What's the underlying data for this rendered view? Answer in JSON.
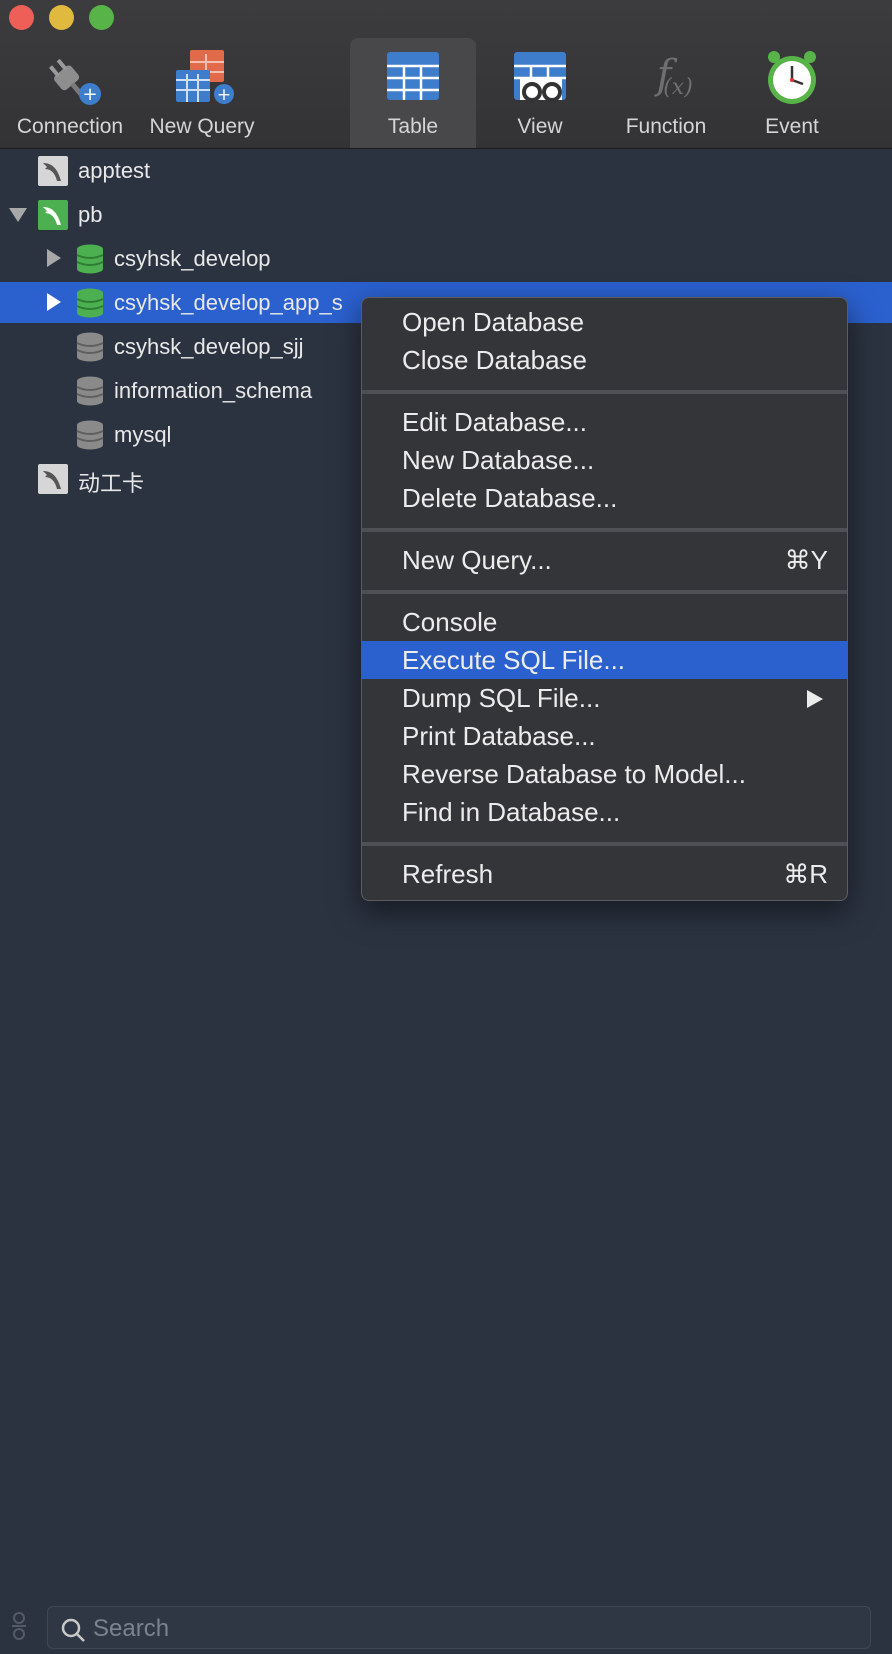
{
  "toolbar": {
    "items": [
      {
        "label": "Connection",
        "icon": "connection-plug-icon"
      },
      {
        "label": "New Query",
        "icon": "new-query-icon"
      },
      {
        "label": "Table",
        "icon": "table-icon",
        "active": true
      },
      {
        "label": "View",
        "icon": "view-icon"
      },
      {
        "label": "Function",
        "icon": "function-icon"
      },
      {
        "label": "Event",
        "icon": "event-clock-icon"
      }
    ]
  },
  "tree": {
    "items": [
      {
        "label": "apptest",
        "icon": "mysql-connection-icon",
        "level": 0
      },
      {
        "label": "pb",
        "icon": "mysql-connection-active-icon",
        "level": 0,
        "expanded": true
      },
      {
        "label": "csyhsk_develop",
        "icon": "database-open-icon",
        "level": 1
      },
      {
        "label": "csyhsk_develop_app_s",
        "icon": "database-open-icon",
        "level": 1,
        "selected": true
      },
      {
        "label": "csyhsk_develop_sjj",
        "icon": "database-closed-icon",
        "level": 1
      },
      {
        "label": "information_schema",
        "icon": "database-closed-icon",
        "level": 1
      },
      {
        "label": "mysql",
        "icon": "database-closed-icon",
        "level": 1
      },
      {
        "label": "动工卡",
        "icon": "mysql-connection-icon",
        "level": 0
      }
    ]
  },
  "context_menu": {
    "items": [
      {
        "label": "Open Database"
      },
      {
        "label": "Close Database"
      },
      {
        "label": "Edit Database..."
      },
      {
        "label": "New Database..."
      },
      {
        "label": "Delete Database..."
      },
      {
        "label": "New Query...",
        "shortcut": "⌘Y"
      },
      {
        "label": "Console"
      },
      {
        "label": "Execute SQL File...",
        "highlighted": true
      },
      {
        "label": "Dump SQL File...",
        "submenu": true
      },
      {
        "label": "Print Database..."
      },
      {
        "label": "Reverse Database to Model..."
      },
      {
        "label": "Find in Database..."
      },
      {
        "label": "Refresh",
        "shortcut": "⌘R"
      }
    ]
  },
  "search": {
    "placeholder": "Search"
  },
  "colors": {
    "selection": "#2b60cf",
    "background": "#2b3341",
    "menu_bg": "#333539",
    "db_open": "#4caf50",
    "db_closed": "#8a8a8a"
  }
}
